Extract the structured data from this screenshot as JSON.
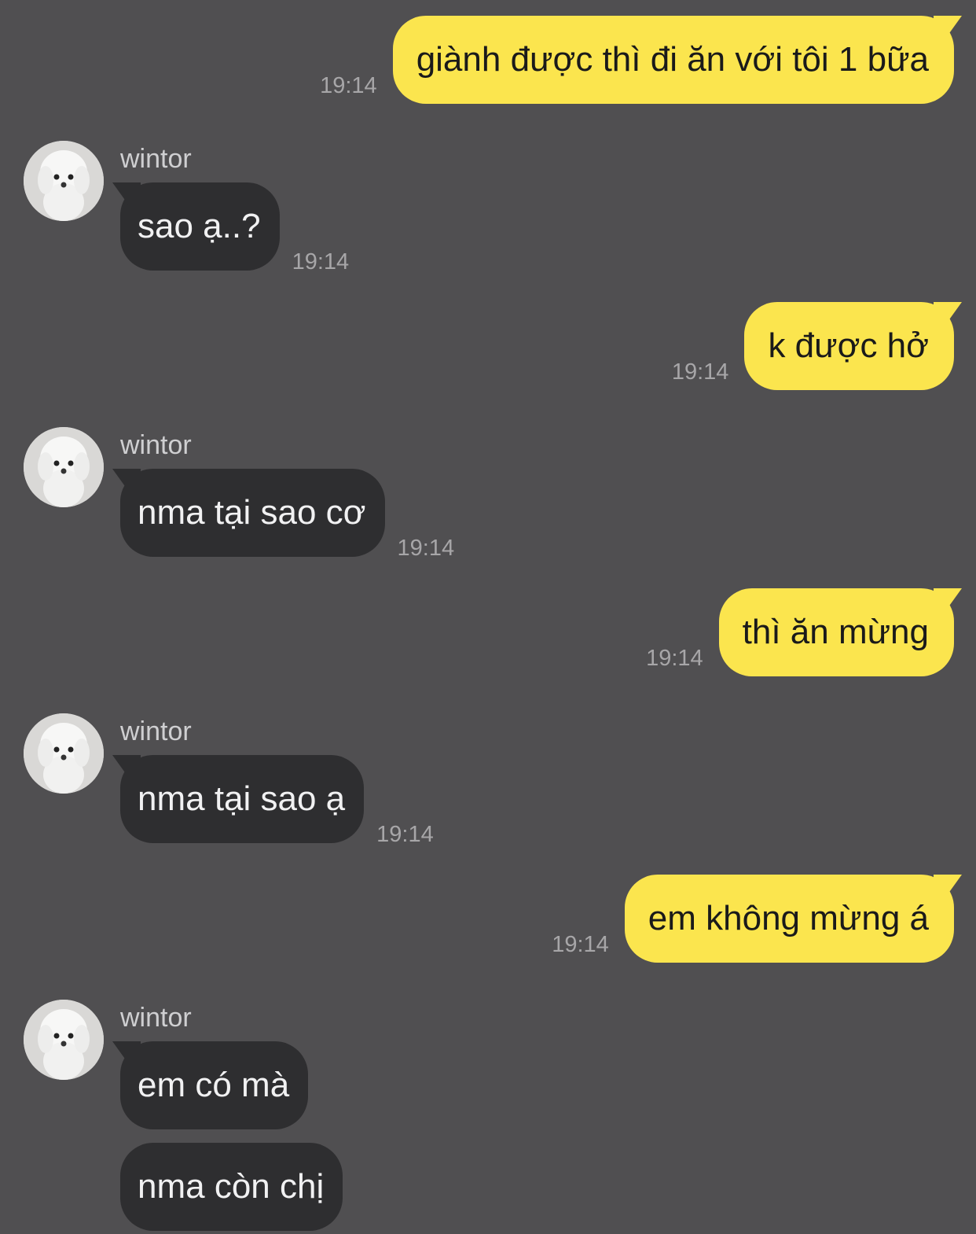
{
  "messages": [
    {
      "text": "giành được thì đi ăn với tôi 1 bữa",
      "time": "19:14"
    },
    {
      "sender": "wintor",
      "text": "sao ạ..?",
      "time": "19:14"
    },
    {
      "text": "k được hở",
      "time": "19:14"
    },
    {
      "sender": "wintor",
      "text": "nma tại sao cơ",
      "time": "19:14"
    },
    {
      "text": "thì ăn mừng",
      "time": "19:14"
    },
    {
      "sender": "wintor",
      "text": "nma tại sao ạ",
      "time": "19:14"
    },
    {
      "text": "em không mừng á",
      "time": "19:14"
    },
    {
      "sender": "wintor",
      "text": "em có mà"
    },
    {
      "text": "nma còn chị"
    }
  ],
  "avatar_icon": "dog-avatar-icon"
}
